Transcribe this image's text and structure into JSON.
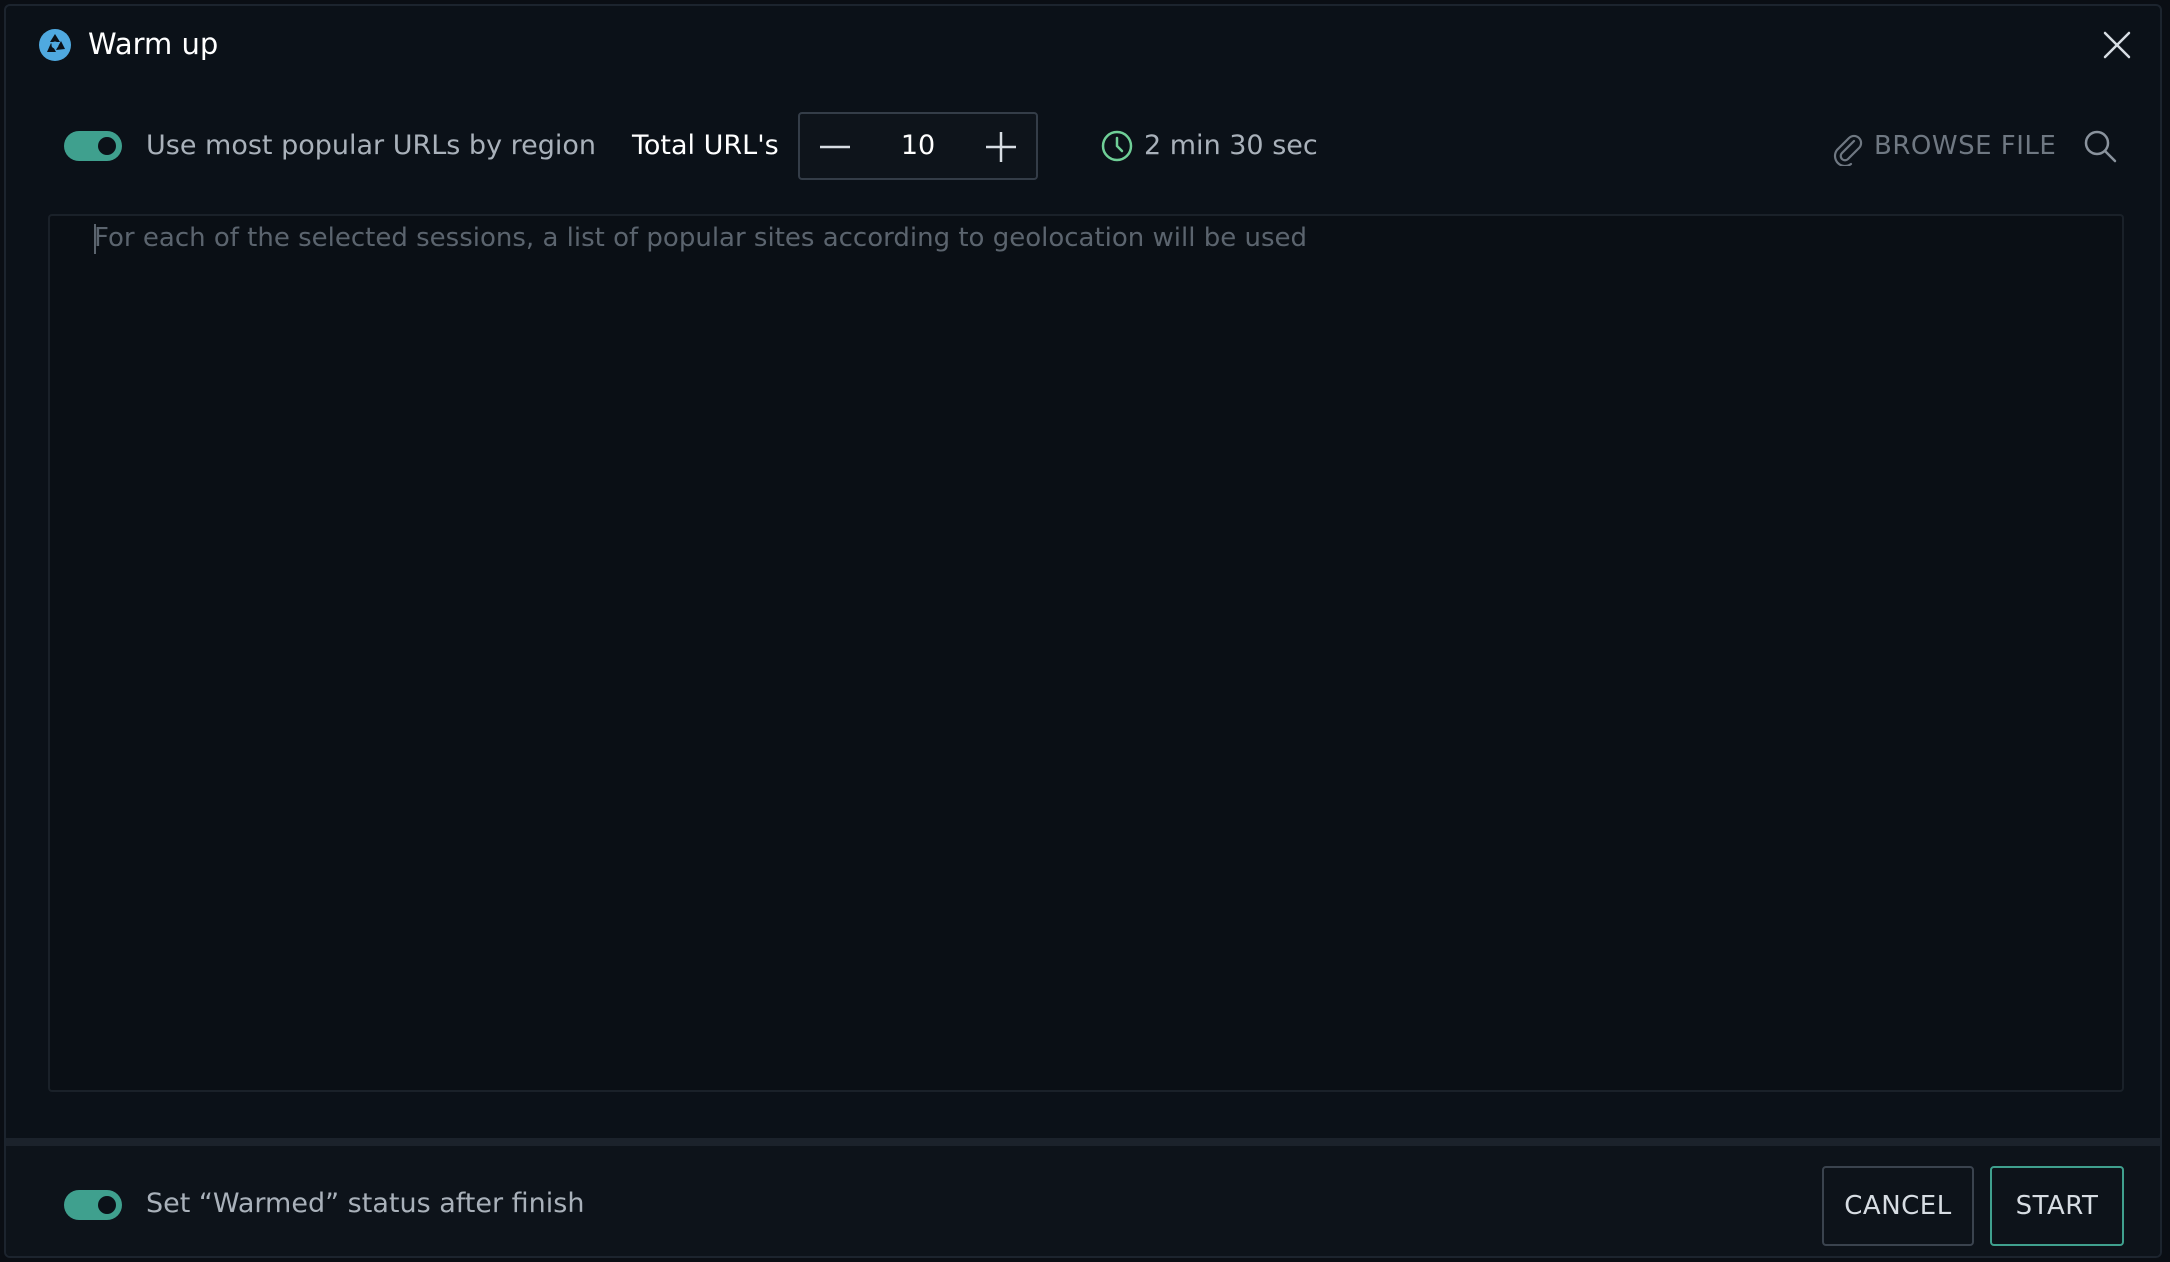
{
  "dialog": {
    "title": "Warm up",
    "logo_icon": "browser-logo-icon",
    "close_icon": "close-icon"
  },
  "toolbar": {
    "popular_urls_toggle": {
      "on": true,
      "label": "Use most popular URLs by region"
    },
    "total_urls_label": "Total URL's",
    "total_urls_value": "10",
    "duration_icon": "clock-icon",
    "duration": "2 min 30 sec",
    "browse_file_label": "BROWSE FILE",
    "browse_icon": "paperclip-icon",
    "search_icon": "search-icon"
  },
  "url_list": {
    "placeholder": "For each of the selected sessions, a list of popular sites according to geolocation will be used",
    "value": ""
  },
  "footer": {
    "warmed_toggle": {
      "on": true,
      "label": "Set “Warmed” status after finish"
    },
    "cancel_label": "CANCEL",
    "start_label": "START"
  },
  "colors": {
    "accent": "#3fa08e",
    "background": "#0b1118",
    "logo": "#4fa9e0",
    "clock": "#6fcf97"
  }
}
